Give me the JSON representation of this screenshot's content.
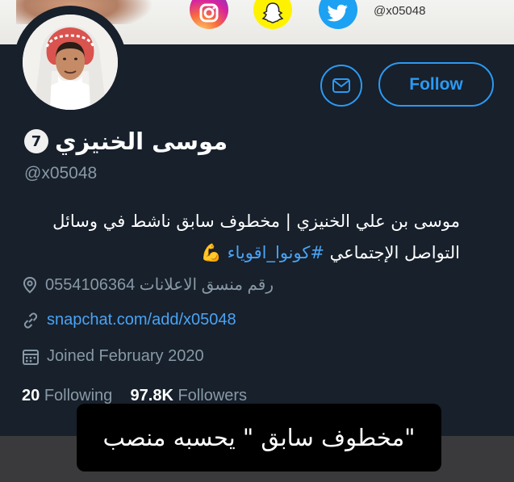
{
  "banner": {
    "icons": [
      "instagram-icon",
      "snapchat-icon",
      "twitter-icon"
    ],
    "handle": "@x05048"
  },
  "profile": {
    "display_name": "موسى الخنيزي",
    "badge": "7",
    "handle": "@x05048",
    "follow_label": "Follow",
    "bio_line1": "موسى بن علي الخنيزي | مخطوف سابق ناشط في وسائل",
    "bio_line2_text": "التواصل الإجتماعي ",
    "bio_hashtag": "#كونوا_اقوياء",
    "bio_emoji": "💪",
    "location": "رقم منسق الاعلانات 0554106364",
    "website": "snapchat.com/add/x05048",
    "joined": "Joined February 2020",
    "following_count": "20",
    "following_label": "Following",
    "followers_count": "97.8K",
    "followers_label": "Followers"
  },
  "caption": "\"مخطوف سابق \" يحسبه منصب",
  "colors": {
    "background": "#17202b",
    "accent": "#2b9af3",
    "muted_text": "#8899a6",
    "link": "#4aa3f5"
  }
}
